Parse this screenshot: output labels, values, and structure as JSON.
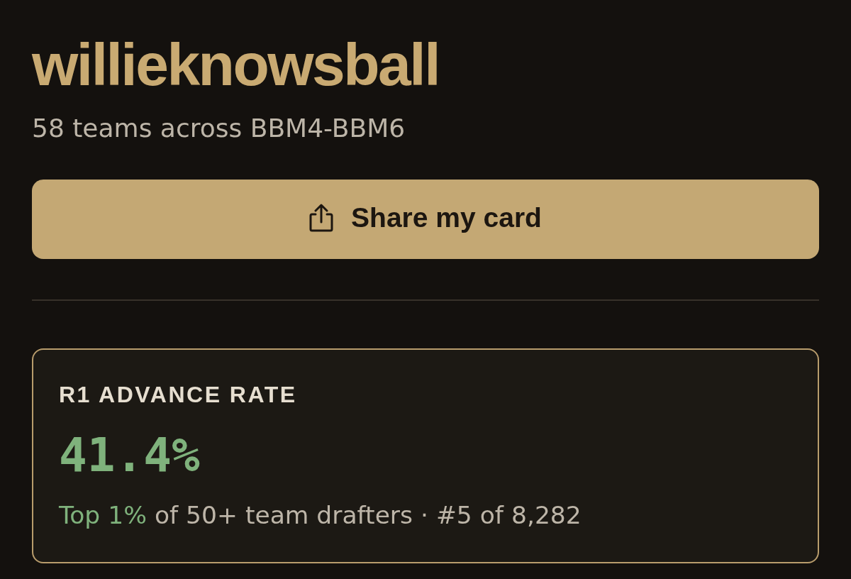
{
  "profile": {
    "username": "willieknowsball",
    "summary": "58 teams across BBM4-BBM6"
  },
  "share_button": {
    "label": "Share my card"
  },
  "stat_card": {
    "label": "R1 ADVANCE RATE",
    "value": "41.4%",
    "percentile": "Top 1%",
    "detail": "of 50+ team drafters · #5 of 8,282"
  }
}
